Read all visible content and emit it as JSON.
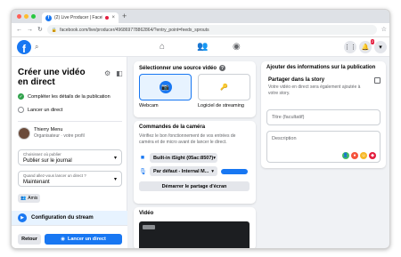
{
  "browser": {
    "tab_title": "(2) Live Producer | Faceb",
    "tab_close": "×",
    "new_tab": "+",
    "url": "facebook.com/live/producer/496869778862864/?entry_point=feedx_sprouts",
    "nav": {
      "back": "←",
      "forward": "→",
      "reload": "↻"
    }
  },
  "header": {
    "logo": "f",
    "notif_badge": "2",
    "colors": {
      "brand": "#1877f2"
    }
  },
  "left": {
    "title": "Créer une vidéo en direct",
    "steps": [
      {
        "label": "Compléter les détails de la publication",
        "done": true
      },
      {
        "label": "Lancer un direct",
        "done": false
      }
    ],
    "profile": {
      "name": "Thierry Menu",
      "role": "Organisateur · votre profil"
    },
    "publish_select": {
      "label": "Choisissez où publier",
      "value": "Publier sur le journal"
    },
    "when_select": {
      "label": "Quand allez-vous lancer un direct ?",
      "value": "Maintenant"
    },
    "audience": "Amis",
    "config": "Configuration du stream",
    "back_button": "Retour",
    "live_button": "Lancer un direct"
  },
  "source": {
    "title": "Sélectionner une source vidéo",
    "help": "?",
    "options": [
      {
        "label": "Webcam",
        "icon": "camera-icon",
        "selected": true
      },
      {
        "label": "Logiciel de streaming",
        "icon": "key-icon",
        "selected": false
      }
    ]
  },
  "camera": {
    "title": "Commandes de la caméra",
    "description": "Vérifiez le bon fonctionnement de vos entrées de caméra et de micro avant de lancer le direct.",
    "video_device": "Built-in iSight (05ac:8507)",
    "audio_device": "Par défaut - Internal M...",
    "screen_share": "Démarrer le partage d'écran"
  },
  "video": {
    "title": "Vidéo"
  },
  "details": {
    "title": "Ajouter des informations sur la publication",
    "story_label": "Partager dans la story",
    "story_desc": "Votre vidéo en direct sera également ajoutée à votre story.",
    "title_placeholder": "Titre (facultatif)",
    "desc_placeholder": "Description"
  }
}
